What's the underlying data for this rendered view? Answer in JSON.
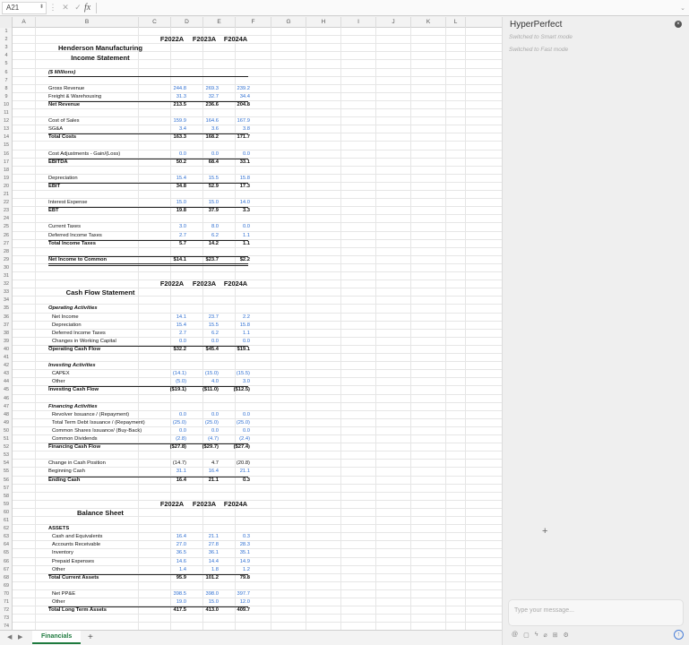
{
  "formula_bar": {
    "cell_ref": "A21",
    "fx": "fx"
  },
  "columns": [
    "A",
    "B",
    "C",
    "D",
    "E",
    "F",
    "G",
    "H",
    "I",
    "J",
    "K",
    "L"
  ],
  "year_headers": [
    "F2022A",
    "F2023A",
    "F2024A"
  ],
  "statements": {
    "income_title_1": "Henderson Manufacturing",
    "income_title_2": "Income Statement",
    "millions_note": "($ Millions)",
    "cash_title": "Cash Flow Statement",
    "balance_title": "Balance Sheet"
  },
  "rows": [
    {
      "r": 8,
      "label": "Gross Revenue",
      "v": [
        "244.8",
        "269.3",
        "239.2"
      ],
      "blue": true
    },
    {
      "r": 9,
      "label": "Freight & Warehousing",
      "v": [
        "31.3",
        "32.7",
        "34.4"
      ],
      "blue": true
    },
    {
      "r": 10,
      "label": "Net Revenue",
      "v": [
        "213.5",
        "236.6",
        "204.8"
      ],
      "bold": true
    },
    {
      "r": 12,
      "label": "Cost of Sales",
      "v": [
        "159.9",
        "164.6",
        "167.9"
      ],
      "blue": true
    },
    {
      "r": 13,
      "label": "SG&A",
      "v": [
        "3.4",
        "3.6",
        "3.8"
      ],
      "blue": true
    },
    {
      "r": 14,
      "label": "Total Costs",
      "v": [
        "163.3",
        "168.2",
        "171.7"
      ],
      "bold": true
    },
    {
      "r": 16,
      "label": "Cost Adjustments - Gain/(Loss)",
      "v": [
        "0.0",
        "0.0",
        "0.0"
      ],
      "blue": true
    },
    {
      "r": 17,
      "label": "EBITDA",
      "v": [
        "50.2",
        "68.4",
        "33.1"
      ],
      "bold": true
    },
    {
      "r": 19,
      "label": "Depreciation",
      "v": [
        "15.4",
        "15.5",
        "15.8"
      ],
      "blue": true
    },
    {
      "r": 20,
      "label": "EBIT",
      "v": [
        "34.8",
        "52.9",
        "17.3"
      ],
      "bold": true
    },
    {
      "r": 22,
      "label": "Interest Expense",
      "v": [
        "15.0",
        "15.0",
        "14.0"
      ],
      "blue": true
    },
    {
      "r": 23,
      "label": "EBT",
      "v": [
        "19.8",
        "37.9",
        "3.3"
      ],
      "bold": true
    },
    {
      "r": 25,
      "label": "Current Taxes",
      "v": [
        "3.0",
        "8.0",
        "0.0"
      ],
      "blue": true
    },
    {
      "r": 26,
      "label": "Deferred Income Taxes",
      "v": [
        "2.7",
        "6.2",
        "1.1"
      ],
      "blue": true
    },
    {
      "r": 27,
      "label": "Total Income Taxes",
      "v": [
        "5.7",
        "14.2",
        "1.1"
      ],
      "bold": true
    },
    {
      "r": 29,
      "label": "Net Income to Common",
      "v": [
        "$14.1",
        "$23.7",
        "$2.2"
      ],
      "bold": true
    },
    {
      "r": 35,
      "label": "Operating Activities",
      "section": true
    },
    {
      "r": 36,
      "label": "Net Income",
      "v": [
        "14.1",
        "23.7",
        "2.2"
      ],
      "blue": true,
      "indent": true
    },
    {
      "r": 37,
      "label": "Depreciation",
      "v": [
        "15.4",
        "15.5",
        "15.8"
      ],
      "blue": true,
      "indent": true
    },
    {
      "r": 38,
      "label": "Deferred Income Taxes",
      "v": [
        "2.7",
        "6.2",
        "1.1"
      ],
      "blue": true,
      "indent": true
    },
    {
      "r": 39,
      "label": "Changes in Working Capital",
      "v": [
        "0.0",
        "0.0",
        "0.0"
      ],
      "blue": true,
      "indent": true
    },
    {
      "r": 40,
      "label": "Operating Cash Flow",
      "v": [
        "$32.2",
        "$45.4",
        "$19.1"
      ],
      "bold": true
    },
    {
      "r": 42,
      "label": "Investing Activities",
      "section": true
    },
    {
      "r": 43,
      "label": "CAPEX",
      "v": [
        "(14.1)",
        "(15.0)",
        "(15.5)"
      ],
      "blue": true,
      "indent": true
    },
    {
      "r": 44,
      "label": "Other",
      "v": [
        "(5.0)",
        "4.0",
        "3.0"
      ],
      "blue": true,
      "indent": true
    },
    {
      "r": 45,
      "label": "Investing Cash Flow",
      "v": [
        "($19.1)",
        "($11.0)",
        "($12.5)"
      ],
      "bold": true
    },
    {
      "r": 47,
      "label": "Financing Activities",
      "section": true
    },
    {
      "r": 48,
      "label": "Revolver Issuance / (Repayment)",
      "v": [
        "0.0",
        "0.0",
        "0.0"
      ],
      "blue": true,
      "indent": true
    },
    {
      "r": 49,
      "label": "Total Term Debt Issuance / (Repayment)",
      "v": [
        "(25.0)",
        "(25.0)",
        "(25.0)"
      ],
      "blue": true,
      "indent": true
    },
    {
      "r": 50,
      "label": "Common Shares Issuance/ (Buy-Back)",
      "v": [
        "0.0",
        "0.0",
        "0.0"
      ],
      "blue": true,
      "indent": true
    },
    {
      "r": 51,
      "label": "Common Dividends",
      "v": [
        "(2.8)",
        "(4.7)",
        "(2.4)"
      ],
      "blue": true,
      "indent": true
    },
    {
      "r": 52,
      "label": "Financing Cash Flow",
      "v": [
        "($27.8)",
        "($29.7)",
        "($27.4)"
      ],
      "bold": true
    },
    {
      "r": 54,
      "label": "Change in Cash Position",
      "v": [
        "(14.7)",
        "4.7",
        "(20.8)"
      ]
    },
    {
      "r": 55,
      "label": "Beginning Cash",
      "v": [
        "31.1",
        "16.4",
        "21.1"
      ],
      "blue": true
    },
    {
      "r": 56,
      "label": "Ending Cash",
      "v": [
        "16.4",
        "21.1",
        "0.3"
      ],
      "bold": true
    },
    {
      "r": 62,
      "label": "ASSETS",
      "section": true,
      "plain": true
    },
    {
      "r": 63,
      "label": "Cash and Equivalents",
      "v": [
        "16.4",
        "21.1",
        "0.3"
      ],
      "blue": true,
      "indent": true
    },
    {
      "r": 64,
      "label": "Accounts Receivable",
      "v": [
        "27.0",
        "27.8",
        "28.3"
      ],
      "blue": true,
      "indent": true
    },
    {
      "r": 65,
      "label": "Inventory",
      "v": [
        "36.5",
        "36.1",
        "35.1"
      ],
      "blue": true,
      "indent": true
    },
    {
      "r": 66,
      "label": "Prepaid Expenses",
      "v": [
        "14.6",
        "14.4",
        "14.9"
      ],
      "blue": true,
      "indent": true
    },
    {
      "r": 67,
      "label": "Other",
      "v": [
        "1.4",
        "1.8",
        "1.2"
      ],
      "blue": true,
      "indent": true
    },
    {
      "r": 68,
      "label": "Total Current Assets",
      "v": [
        "95.9",
        "101.2",
        "79.8"
      ],
      "bold": true
    },
    {
      "r": 70,
      "label": "Net PP&E",
      "v": [
        "398.5",
        "398.0",
        "397.7"
      ],
      "blue": true,
      "indent": true
    },
    {
      "r": 71,
      "label": "Other",
      "v": [
        "19.0",
        "15.0",
        "12.0"
      ],
      "blue": true,
      "indent": true
    },
    {
      "r": 72,
      "label": "Total Long Term Assets",
      "v": [
        "417.5",
        "413.0",
        "409.7"
      ],
      "bold": true
    }
  ],
  "tabs": {
    "prev": "◀",
    "next": "▶",
    "active": "Financials",
    "add": "+"
  },
  "panel": {
    "title": "HyperPerfect",
    "close": "×",
    "msg1": "Switched to Smart mode",
    "msg2": "Switched to Fast mode",
    "cursor": "+",
    "placeholder": "Type your message...",
    "send": "↑"
  }
}
